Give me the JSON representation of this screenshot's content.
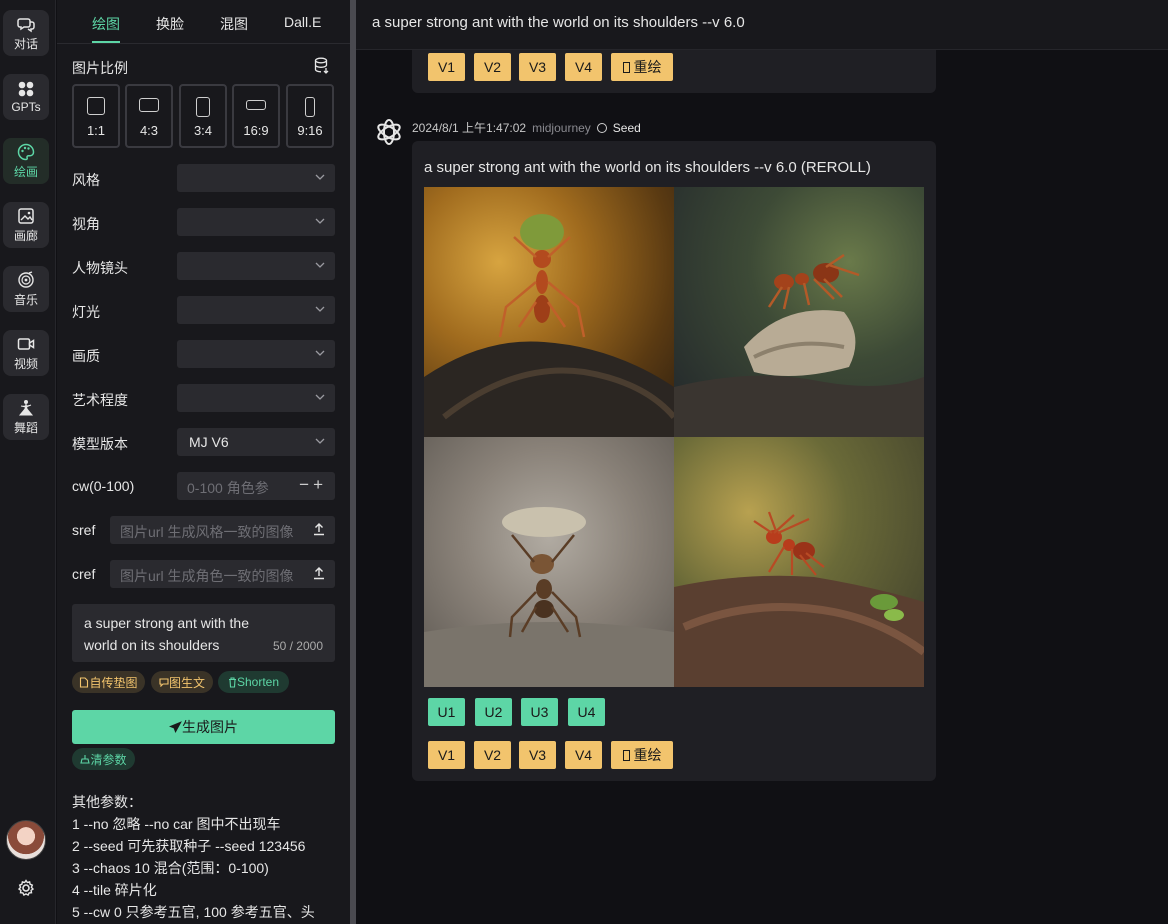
{
  "rail": {
    "items": [
      {
        "label": "对话",
        "icon": "chat-icon"
      },
      {
        "label": "GPTs",
        "icon": "grid-icon"
      },
      {
        "label": "绘画",
        "icon": "palette-icon"
      },
      {
        "label": "画廊",
        "icon": "image-icon"
      },
      {
        "label": "音乐",
        "icon": "music-icon"
      },
      {
        "label": "视频",
        "icon": "video-icon"
      },
      {
        "label": "舞蹈",
        "icon": "dance-icon"
      }
    ],
    "active_index": 2
  },
  "panel": {
    "tabs": [
      "绘图",
      "换脸",
      "混图",
      "Dall.E"
    ],
    "active_tab": 0,
    "ratio_title": "图片比例",
    "ratios": [
      "1:1",
      "4:3",
      "3:4",
      "16:9",
      "9:16"
    ],
    "fields": {
      "style_label": "风格",
      "style_value": "",
      "view_label": "视角",
      "view_value": "",
      "shot_label": "人物镜头",
      "shot_value": "",
      "light_label": "灯光",
      "light_value": "",
      "quality_label": "画质",
      "quality_value": "",
      "art_label": "艺术程度",
      "art_value": "",
      "model_label": "模型版本",
      "model_value": "MJ V6",
      "cw_label": "cw(0-100)",
      "cw_placeholder": "0-100 角色参",
      "sref_label": "sref",
      "sref_placeholder": "图片url 生成风格一致的图像",
      "cref_label": "cref",
      "cref_placeholder": "图片url 生成角色一致的图像"
    },
    "prompt": {
      "text": "a super strong ant with the world on its shoulders",
      "count": "50 / 2000"
    },
    "chips": {
      "upload": "自传垫图",
      "img2text": "图生文",
      "shorten": "Shorten"
    },
    "generate_label": "生成图片",
    "clear_label": "清参数",
    "params": [
      "其他参数：",
      "1 --no 忽略 --no car 图中不出现车",
      "2 --seed 可先获取种子 --seed 123456",
      "3 --chaos 10 混合(范围：0-100)",
      "4 --tile 碎片化",
      "5 --cw 0 只参考五官, 100 参考五官、头"
    ]
  },
  "main": {
    "title": "a super strong ant with the world on its shoulders --v 6.0",
    "top_buttons": [
      "V1",
      "V2",
      "V3",
      "V4"
    ],
    "redraw_label": "重绘",
    "message": {
      "time": "2024/8/1 上午1:47:02",
      "source": "midjourney",
      "seed_label": "Seed",
      "prompt": "a super strong ant with the world on its shoulders --v 6.0 (REROLL)",
      "u_buttons": [
        "U1",
        "U2",
        "U3",
        "U4"
      ],
      "v_buttons": [
        "V1",
        "V2",
        "V3",
        "V4"
      ],
      "redraw_label": "重绘"
    }
  },
  "colors": {
    "accent": "#5dd6a6",
    "variation": "#f2c46d",
    "panel": "#18181c",
    "bg": "#101014"
  }
}
